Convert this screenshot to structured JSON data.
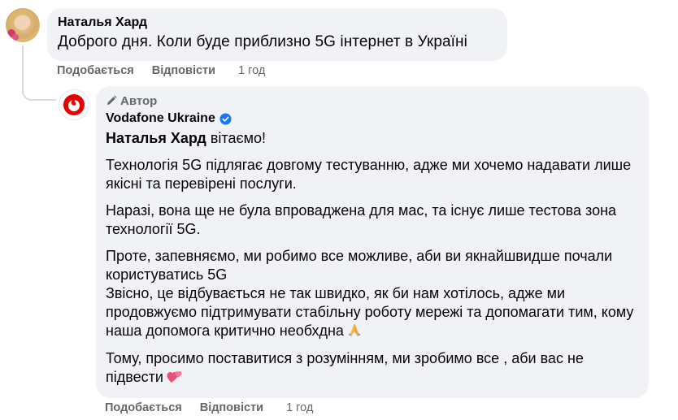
{
  "comment": {
    "author": "Наталья Хард",
    "text": "Доброго дня. Коли буде приблизно 5G інтернет в Україні",
    "like_label": "Подобається",
    "reply_label": "Відповісти",
    "time": "1 год"
  },
  "reply": {
    "badge": "Автор",
    "author": "Vodafone Ukraine",
    "mention": "Наталья Хард",
    "greeting": " вітаємо!",
    "p1": "Технологія 5G підлягає довгому тестуванню, адже ми хочемо надавати лише якісні та перевірені послуги.",
    "p2": "Наразі, вона ще не була впроваджена для мас, та існує лише тестова зона технології 5G.",
    "p3a": "Проте, запевняємо, ми робимо все можливе, аби ви якнайшвидше почали користуватись 5G",
    "p3b": "Звісно, це відбувається не так швидко, як би нам хотілось, адже ми продовжуємо підтримувати стабільну роботу мережі та допомагати тим, кому наша допомога критично необхдна",
    "p4": "Тому, просимо поставитися з розумінням, ми зробимо все , аби вас не підвести",
    "like_label": "Подобається",
    "reply_label": "Відповісти",
    "time": "1 год",
    "icons": [
      "pencil-icon",
      "verified-badge-icon",
      "praying-hands-emoji",
      "two-hearts-emoji"
    ]
  },
  "colors": {
    "bubble": "#f0f2f5",
    "meta_text": "#65676b",
    "verified_blue": "#1877f2",
    "vodafone_red": "#e60000"
  }
}
